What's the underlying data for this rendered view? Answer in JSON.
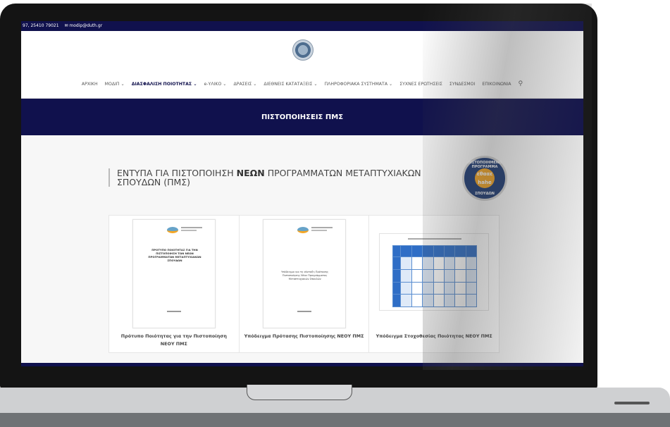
{
  "topbar": {
    "phone": "97, 25410 79021",
    "email": "modip@duth.gr",
    "mail_icon": "envelope-icon"
  },
  "nav": {
    "items": [
      {
        "label": "ΑΡΧΙΚΗ",
        "dropdown": false
      },
      {
        "label": "ΜΟΔΙΠ",
        "dropdown": true
      },
      {
        "label": "ΔΙΑΣΦΑΛΙΣΗ ΠΟΙΟΤΗΤΑΣ",
        "dropdown": true,
        "active": true
      },
      {
        "label": "e-ΥΛΙΚΟ",
        "dropdown": true
      },
      {
        "label": "ΔΡΑΣΕΙΣ",
        "dropdown": true
      },
      {
        "label": "ΔΙΕΘΝΕΙΣ ΚΑΤΑΤΑΞΕΙΣ",
        "dropdown": true
      },
      {
        "label": "ΠΛΗΡΟΦΟΡΙΑΚΑ ΣΥΣΤΗΜΑΤΑ",
        "dropdown": true
      },
      {
        "label": "ΣΥΧΝΕΣ ΕΡΩΤΗΣΕΙΣ",
        "dropdown": false
      },
      {
        "label": "ΣΥΝΔΕΣΜΟΙ",
        "dropdown": false
      },
      {
        "label": "ΕΠΙΚΟΙΝΩΝΙΑ",
        "dropdown": false
      }
    ],
    "dropdown_glyph": "⌄",
    "search_icon": "search-icon",
    "search_glyph": "⚲"
  },
  "banner": {
    "title": "ΠΙΣΤΟΠΟΙΗΣΕΙΣ ΠΜΣ"
  },
  "section": {
    "heading_pre": "ΕΝΤΥΠΑ ΓΙΑ ΠΙΣΤΟΠΟΙΗΣΗ ",
    "heading_bold": "ΝΕΩΝ",
    "heading_post": " ΠΡΟΓΡΑΜΜΑΤΩΝ ΜΕΤΑΠΤΥΧΙΑΚΩΝ ΣΠΟΥΔΩΝ (ΠΜΣ)"
  },
  "badge": {
    "top": "ΠΙΣΤΟΠΟΙΗΜΕΝΟ ΠΡΟΓΡΑΜΜΑ",
    "line1": "εθααε",
    "line2": "hahe",
    "bottom": "ΣΠΟΥΔΩΝ"
  },
  "cards": [
    {
      "caption": "Πρότυπο Ποιότητας για την Πιστοποίηση ΝΕΟΥ ΠΜΣ",
      "doc_title": "ΠΡΟΤΥΠΟ ΠΟΙΟΤΗΤΑΣ ΓΙΑ ΤΗΝ ΠΙΣΤΟΠΟΙΗΣΗ ΤΩΝ ΝΕΩΝ ΠΡΟΓΡΑΜΜΑΤΩΝ ΜΕΤΑΠΤΥΧΙΑΚΩΝ ΣΠΟΥΔΩΝ"
    },
    {
      "caption": "Υπόδειγμα Πρότασης Πιστοποίησης ΝΕΟΥ ΠΜΣ",
      "doc_title": "Υπόδειγμα για τη σύνταξη Πρότασης Πιστοποίησης Νέου Προγράμματος Μεταπτυχιακών Σπουδών"
    },
    {
      "caption": "Υπόδειγμα Στοχοθεσίας Ποιότητας ΝΕΟΥ ΠΜΣ"
    }
  ]
}
